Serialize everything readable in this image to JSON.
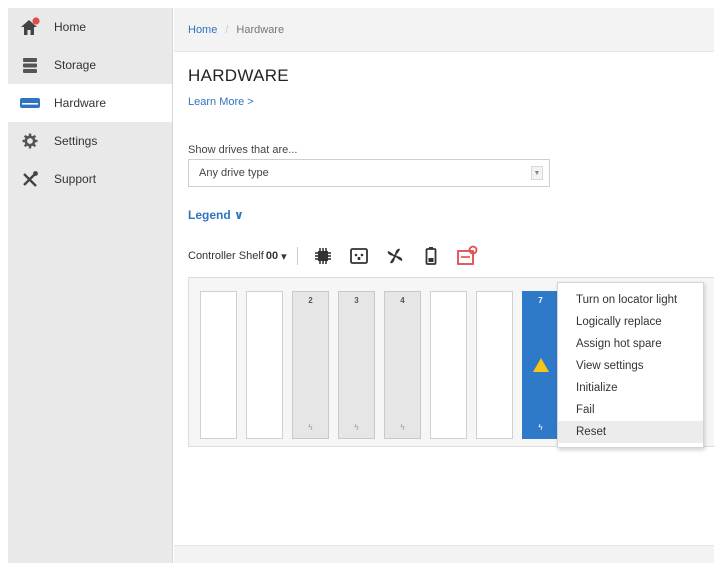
{
  "sidebar": {
    "items": [
      {
        "label": "Home",
        "icon": "home-icon"
      },
      {
        "label": "Storage",
        "icon": "storage-icon"
      },
      {
        "label": "Hardware",
        "icon": "hardware-icon",
        "active": true
      },
      {
        "label": "Settings",
        "icon": "gear-icon"
      },
      {
        "label": "Support",
        "icon": "tools-icon"
      }
    ]
  },
  "breadcrumb": {
    "home": "Home",
    "sep": "/",
    "current": "Hardware"
  },
  "page": {
    "title": "HARDWARE",
    "learn_more": "Learn More >"
  },
  "filter": {
    "label": "Show drives that are...",
    "selected": "Any drive type",
    "caret": "▼"
  },
  "legend": {
    "label": "Legend ∨"
  },
  "shelf": {
    "prefix": "Controller Shelf",
    "id": "00",
    "caret": "▾",
    "component_icons": [
      "controller-chip-icon",
      "power-supply-icon",
      "fan-icon",
      "battery-icon",
      "alert-shelf-icon"
    ]
  },
  "bays": [
    {
      "num": "",
      "state": "empty"
    },
    {
      "num": "",
      "state": "empty"
    },
    {
      "num": "2",
      "state": "populated",
      "bolt": "ϟ"
    },
    {
      "num": "3",
      "state": "populated",
      "bolt": "ϟ"
    },
    {
      "num": "4",
      "state": "populated",
      "bolt": "ϟ"
    },
    {
      "num": "",
      "state": "empty"
    },
    {
      "num": "",
      "state": "empty"
    },
    {
      "num": "7",
      "state": "selected",
      "bolt": "ϟ",
      "warning": true
    }
  ],
  "context_menu": {
    "items": [
      "Turn on locator light",
      "Logically replace",
      "Assign hot spare",
      "View settings",
      "Initialize",
      "Fail",
      "Reset"
    ],
    "hover_index": 6
  },
  "colors": {
    "accent": "#2f74c0",
    "selected_drive": "#2f7ac8",
    "warning": "#f5c518",
    "alert": "#e14b4b"
  }
}
